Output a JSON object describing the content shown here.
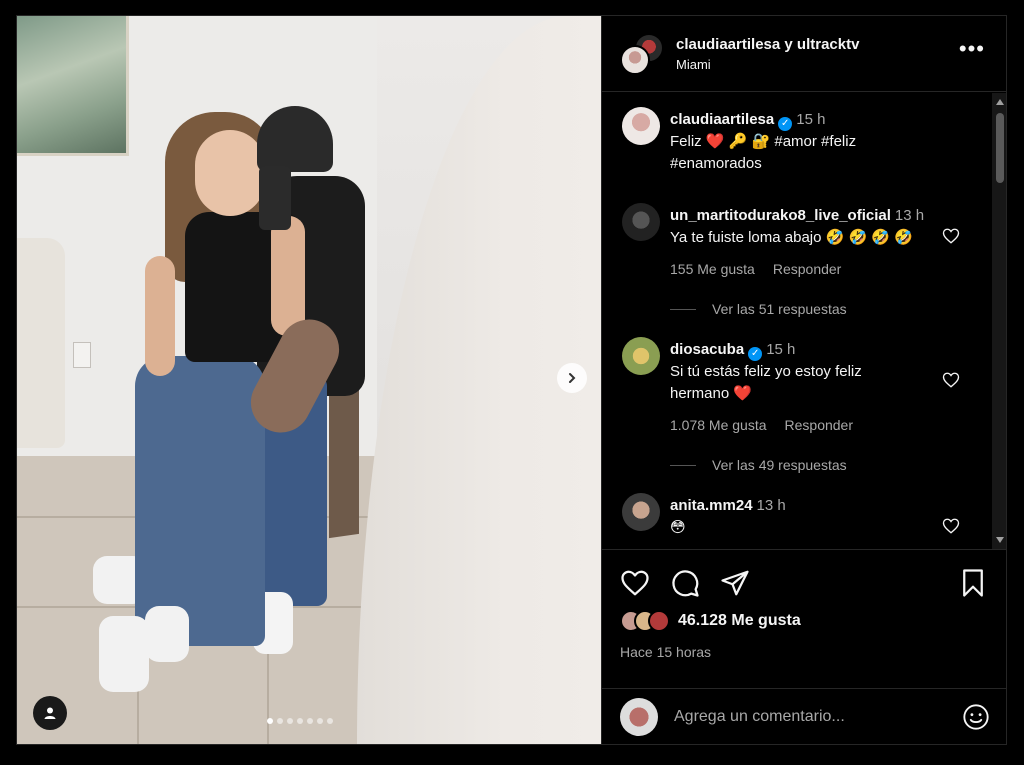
{
  "header": {
    "title": "claudiaartilesa y ultracktv",
    "location": "Miami",
    "more_label": "•••"
  },
  "post": {
    "user": "claudiaartilesa",
    "time": "15 h",
    "verified": true,
    "caption_line1": "Feliz ❤️ 🔑 🔐 #amor #feliz",
    "caption_line2": "#enamorados"
  },
  "comments": [
    {
      "user": "un_martitodurako8_live_oficial",
      "time": "13 h",
      "text": "Ya te fuiste loma abajo 🤣 🤣 🤣 🤣",
      "likes": "155 Me gusta",
      "reply_label": "Responder",
      "replies_label": "Ver las 51 respuestas"
    },
    {
      "user": "diosacuba",
      "verified": true,
      "time": "15 h",
      "text_line1": "Si tú estás feliz yo estoy feliz",
      "text_line2": "hermano ❤️",
      "likes": "1.078 Me gusta",
      "reply_label": "Responder",
      "replies_label": "Ver las 49 respuestas"
    },
    {
      "user": "anita.mm24",
      "time": "13 h",
      "text": "😳"
    }
  ],
  "actions": {
    "likes_count": "46.128 Me gusta",
    "time_ago": "Hace 15 horas",
    "comment_placeholder": "Agrega un comentario..."
  },
  "carousel": {
    "dot_count": 7,
    "active_index": 0
  },
  "colors": {
    "background": "#000000",
    "text": "#f5f5f5",
    "secondary": "#a8a8a8",
    "verified": "#0095f6",
    "heart": "#ed4956"
  }
}
